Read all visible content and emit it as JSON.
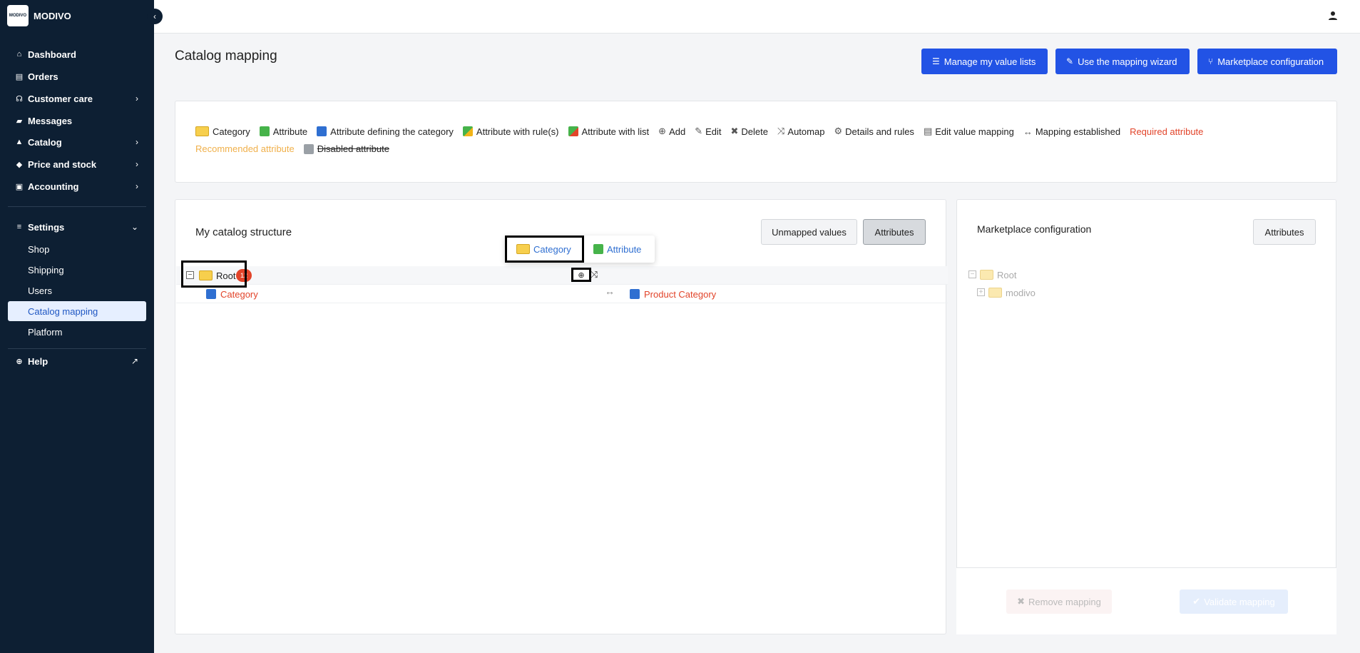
{
  "brand": {
    "logo_text": "MODIVO",
    "name": "MODIVO"
  },
  "sidebar": {
    "items": [
      {
        "label": "Dashboard"
      },
      {
        "label": "Orders"
      },
      {
        "label": "Customer care"
      },
      {
        "label": "Messages"
      },
      {
        "label": "Catalog"
      },
      {
        "label": "Price and stock"
      },
      {
        "label": "Accounting"
      },
      {
        "label": "Settings"
      },
      {
        "label": "Help"
      }
    ],
    "settings_sub": [
      {
        "label": "Shop"
      },
      {
        "label": "Shipping"
      },
      {
        "label": "Users"
      },
      {
        "label": "Catalog mapping"
      },
      {
        "label": "Platform"
      }
    ]
  },
  "page": {
    "title": "Catalog mapping"
  },
  "toolbar": {
    "manage_lists": "Manage my value lists",
    "wizard": "Use the mapping wizard",
    "marketplace_config": "Marketplace configuration"
  },
  "legend": {
    "category": "Category",
    "attribute": "Attribute",
    "attr_defining": "Attribute defining the category",
    "attr_rules": "Attribute with rule(s)",
    "attr_list": "Attribute with list",
    "add": "Add",
    "edit": "Edit",
    "delete": "Delete",
    "automap": "Automap",
    "details": "Details and rules",
    "edit_value_mapping": "Edit value mapping",
    "mapping_established": "Mapping established",
    "required": "Required attribute",
    "recommended": "Recommended attribute",
    "disabled": "Disabled attribute"
  },
  "left_panel": {
    "title": "My catalog structure",
    "unmapped_btn": "Unmapped values",
    "attributes_btn": "Attributes",
    "root_label": "Root",
    "root_count": "12",
    "child_label": "Category",
    "mapped_to": "Product Category",
    "popup": {
      "category": "Category",
      "attribute": "Attribute"
    }
  },
  "right_panel": {
    "title": "Marketplace configuration",
    "attributes_btn": "Attributes",
    "root_label": "Root",
    "child_label": "modivo",
    "remove_btn": "Remove mapping",
    "validate_btn": "Validate mapping"
  },
  "colors": {
    "primary": "#2253e5",
    "sidebar": "#0d1f33",
    "required": "#e2442a",
    "recommended": "#f0b04b"
  }
}
